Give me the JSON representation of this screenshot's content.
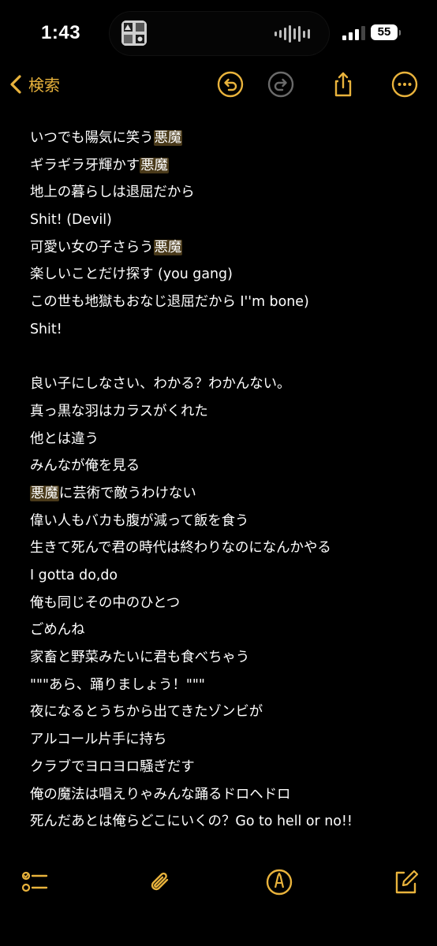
{
  "status_bar": {
    "time": "1:43",
    "battery_level": "55"
  },
  "nav": {
    "back_label": "検索",
    "icons": [
      "chevron-left-icon",
      "undo-icon",
      "redo-icon",
      "share-icon",
      "more-icon"
    ]
  },
  "note": {
    "highlight_term": "悪魔",
    "lines": [
      {
        "segments": [
          {
            "text": "いつでも陽気に笑う"
          },
          {
            "text": "悪魔",
            "hl": true
          }
        ]
      },
      {
        "segments": [
          {
            "text": "ギラギラ牙輝かす"
          },
          {
            "text": "悪魔",
            "hl": true
          }
        ]
      },
      {
        "segments": [
          {
            "text": "地上の暮らしは退屈だから"
          }
        ]
      },
      {
        "segments": [
          {
            "text": "Shit! (Devil)"
          }
        ]
      },
      {
        "segments": [
          {
            "text": "可愛い女の子さらう"
          },
          {
            "text": "悪魔",
            "hl": true
          }
        ]
      },
      {
        "segments": [
          {
            "text": "楽しいことだけ探す (you gang)"
          }
        ]
      },
      {
        "segments": [
          {
            "text": "この世も地獄もおなじ退屈だから I''m bone)"
          }
        ]
      },
      {
        "segments": [
          {
            "text": "Shit!"
          }
        ]
      },
      {
        "segments": []
      },
      {
        "segments": [
          {
            "text": "良い子にしなさい、わかる？わかんない。"
          }
        ]
      },
      {
        "segments": [
          {
            "text": "真っ黒な羽はカラスがくれた"
          }
        ]
      },
      {
        "segments": [
          {
            "text": "他とは違う"
          }
        ]
      },
      {
        "segments": [
          {
            "text": "みんなが俺を見る"
          }
        ]
      },
      {
        "segments": [
          {
            "text": "悪魔",
            "hl": true
          },
          {
            "text": "に芸術で敵うわけない"
          }
        ]
      },
      {
        "segments": [
          {
            "text": "偉い人もバカも腹が減って飯を食う"
          }
        ]
      },
      {
        "segments": [
          {
            "text": "生きて死んで君の時代は終わりなのになんかやる"
          }
        ]
      },
      {
        "segments": [
          {
            "text": "I gotta do,do"
          }
        ]
      },
      {
        "segments": [
          {
            "text": "俺も同じその中のひとつ"
          }
        ]
      },
      {
        "segments": [
          {
            "text": "ごめんね"
          }
        ]
      },
      {
        "segments": [
          {
            "text": "家畜と野菜みたいに君も食べちゃう"
          }
        ]
      },
      {
        "segments": [
          {
            "text": "\"\"\"あら、踊りましょう！\"\"\""
          }
        ]
      },
      {
        "segments": [
          {
            "text": "夜になるとうちから出てきたゾンビが"
          }
        ]
      },
      {
        "segments": [
          {
            "text": "アルコール片手に持ち"
          }
        ]
      },
      {
        "segments": [
          {
            "text": "クラブでヨロヨロ騒ぎだす"
          }
        ]
      },
      {
        "segments": [
          {
            "text": "俺の魔法は唱えりゃみんな踊るドロヘドロ"
          }
        ]
      },
      {
        "segments": [
          {
            "text": "死んだあとは俺らどこにいくの？Go to hell or no!!"
          }
        ]
      }
    ]
  },
  "toolbar": {
    "icons": [
      "checklist-icon",
      "attachment-icon",
      "markup-icon",
      "compose-icon"
    ]
  },
  "colors": {
    "accent": "#e9b33c",
    "highlight_bg": "#4a3a1a",
    "background": "#000000",
    "text": "#ffffff"
  }
}
